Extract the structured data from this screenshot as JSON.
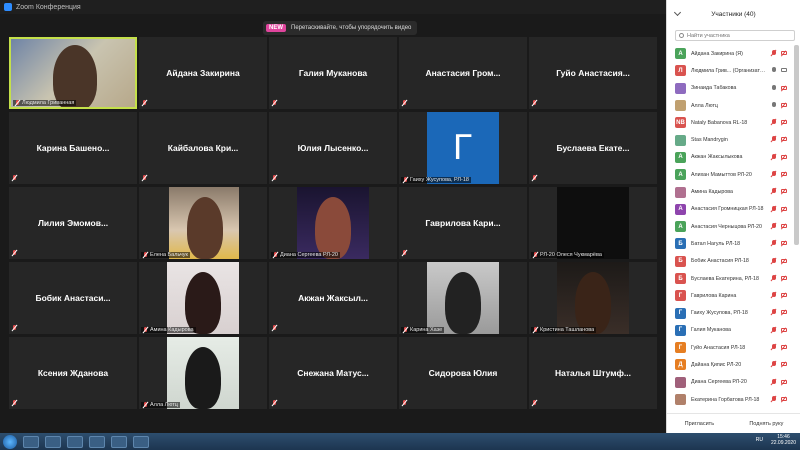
{
  "window": {
    "title": "Zoom Конференция"
  },
  "banner": {
    "badge": "NEW",
    "text": "Перетаскивайте, чтобы упорядочить видео"
  },
  "tiles": [
    {
      "name": "",
      "label": "Людмила Гриванная",
      "video": "host"
    },
    {
      "name": "Айдана Закирина",
      "label": "",
      "video": "none"
    },
    {
      "name": "Галия Муканова",
      "label": "",
      "video": "none"
    },
    {
      "name": "Анастасия Гром...",
      "label": "",
      "video": "none"
    },
    {
      "name": "Гуйо Анастасия...",
      "label": "",
      "video": "none"
    },
    {
      "name": "Карина Башено...",
      "label": "",
      "video": "none"
    },
    {
      "name": "Кайбалова Кри...",
      "label": "",
      "video": "none"
    },
    {
      "name": "Юлия Лысенко...",
      "label": "",
      "video": "none"
    },
    {
      "name": "",
      "label": "Гаиху Жусупова, РЛ-18",
      "video": "letter",
      "letter": "Г"
    },
    {
      "name": "Буслаева Екате...",
      "label": "",
      "video": "none"
    },
    {
      "name": "Лилия Эмомов...",
      "label": "",
      "video": "none"
    },
    {
      "name": "",
      "label": "Елена Бальчук",
      "video": "photo1"
    },
    {
      "name": "",
      "label": "Диана Сергеева РЛ-20",
      "video": "photo2"
    },
    {
      "name": "Гаврилова Кари...",
      "label": "",
      "video": "none"
    },
    {
      "name": "",
      "label": "РЛ-20 Олеся Чукмарёва",
      "video": "dark"
    },
    {
      "name": "Бобик Анастаси...",
      "label": "",
      "video": "none"
    },
    {
      "name": "",
      "label": "Амина Кадырова",
      "video": "photo3"
    },
    {
      "name": "Акжан Жаксыл...",
      "label": "",
      "video": "none"
    },
    {
      "name": "",
      "label": "Карина Хазе",
      "video": "photo4"
    },
    {
      "name": "",
      "label": "Кристина Ташланова",
      "video": "photo5"
    },
    {
      "name": "Ксения Жданова",
      "label": "",
      "video": "none"
    },
    {
      "name": "",
      "label": "Алла Лютц",
      "video": "photo6"
    },
    {
      "name": "Снежана Матус...",
      "label": "",
      "video": "none"
    },
    {
      "name": "Сидорова Юлия",
      "label": "",
      "video": "none"
    },
    {
      "name": "Наталья Штумф...",
      "label": "",
      "video": "none"
    }
  ],
  "panel": {
    "title": "Участники (40)",
    "search_placeholder": "Найти участника",
    "invite": "Пригласить",
    "raise_hand": "Поднять руку",
    "participants": [
      {
        "initial": "А",
        "color": "#4aa35a",
        "name": "Айдана Закирина (Я)",
        "mic": false,
        "cam": false,
        "avatar": "letter"
      },
      {
        "initial": "Л",
        "color": "#d9534f",
        "name": "Людмила Грив... (Организатор)",
        "mic": true,
        "cam": true,
        "avatar": "letter"
      },
      {
        "initial": "З",
        "color": "#8e6bbf",
        "name": "Зинаида Табакова",
        "mic": true,
        "cam": false,
        "avatar": "photo"
      },
      {
        "initial": "А",
        "color": "#c0a070",
        "name": "Алла Лютц",
        "mic": true,
        "cam": false,
        "avatar": "photo"
      },
      {
        "initial": "NB",
        "color": "#d9534f",
        "name": "Nataly Babanova RL-18",
        "mic": false,
        "cam": false,
        "avatar": "letter"
      },
      {
        "initial": "S",
        "color": "#6a8",
        "name": "Stas Mandrygin",
        "mic": false,
        "cam": false,
        "avatar": "photo"
      },
      {
        "initial": "А",
        "color": "#4aa35a",
        "name": "Акжан Жаксылыкова",
        "mic": false,
        "cam": false,
        "avatar": "letter"
      },
      {
        "initial": "А",
        "color": "#4aa35a",
        "name": "Алихан Мамыттов РЛ-20",
        "mic": false,
        "cam": false,
        "avatar": "letter"
      },
      {
        "initial": "А",
        "color": "#b07090",
        "name": "Амина Кадырова",
        "mic": false,
        "cam": false,
        "avatar": "photo"
      },
      {
        "initial": "А",
        "color": "#8e44ad",
        "name": "Анастасия Громницкая РЛ-18",
        "mic": false,
        "cam": false,
        "avatar": "letter"
      },
      {
        "initial": "А",
        "color": "#4aa35a",
        "name": "Анастасия Черныцова РЛ-20",
        "mic": false,
        "cam": false,
        "avatar": "letter"
      },
      {
        "initial": "Б",
        "color": "#2a6fb5",
        "name": "Батал Нагуль РЛ-18",
        "mic": false,
        "cam": false,
        "avatar": "letter"
      },
      {
        "initial": "Б",
        "color": "#d9534f",
        "name": "Бобик Анастасия РЛ-18",
        "mic": false,
        "cam": false,
        "avatar": "letter"
      },
      {
        "initial": "Б",
        "color": "#d9534f",
        "name": "Буслаева Екатерина, РЛ-18",
        "mic": false,
        "cam": false,
        "avatar": "letter"
      },
      {
        "initial": "Г",
        "color": "#d9534f",
        "name": "Гаврилова Карина",
        "mic": false,
        "cam": false,
        "avatar": "letter"
      },
      {
        "initial": "Г",
        "color": "#2a6fb5",
        "name": "Гаиху Жусупова, РЛ-18",
        "mic": false,
        "cam": false,
        "avatar": "letter"
      },
      {
        "initial": "Г",
        "color": "#2a6fb5",
        "name": "Галия Муканова",
        "mic": false,
        "cam": false,
        "avatar": "letter"
      },
      {
        "initial": "Г",
        "color": "#e67e22",
        "name": "Гуйо Анастасия РЛ-18",
        "mic": false,
        "cam": false,
        "avatar": "letter"
      },
      {
        "initial": "Д",
        "color": "#e67e22",
        "name": "Дайана Қипис РЛ-20",
        "mic": false,
        "cam": false,
        "avatar": "letter"
      },
      {
        "initial": "Д",
        "color": "#a0607a",
        "name": "Диана Сергеева РЛ-20",
        "mic": false,
        "cam": false,
        "avatar": "photo"
      },
      {
        "initial": "Е",
        "color": "#b0806a",
        "name": "Екатерина Горбатова РЛ-18",
        "mic": false,
        "cam": false,
        "avatar": "photo"
      }
    ]
  },
  "taskbar": {
    "lang": "RU",
    "time": "15:46",
    "date": "22.09.2020"
  }
}
